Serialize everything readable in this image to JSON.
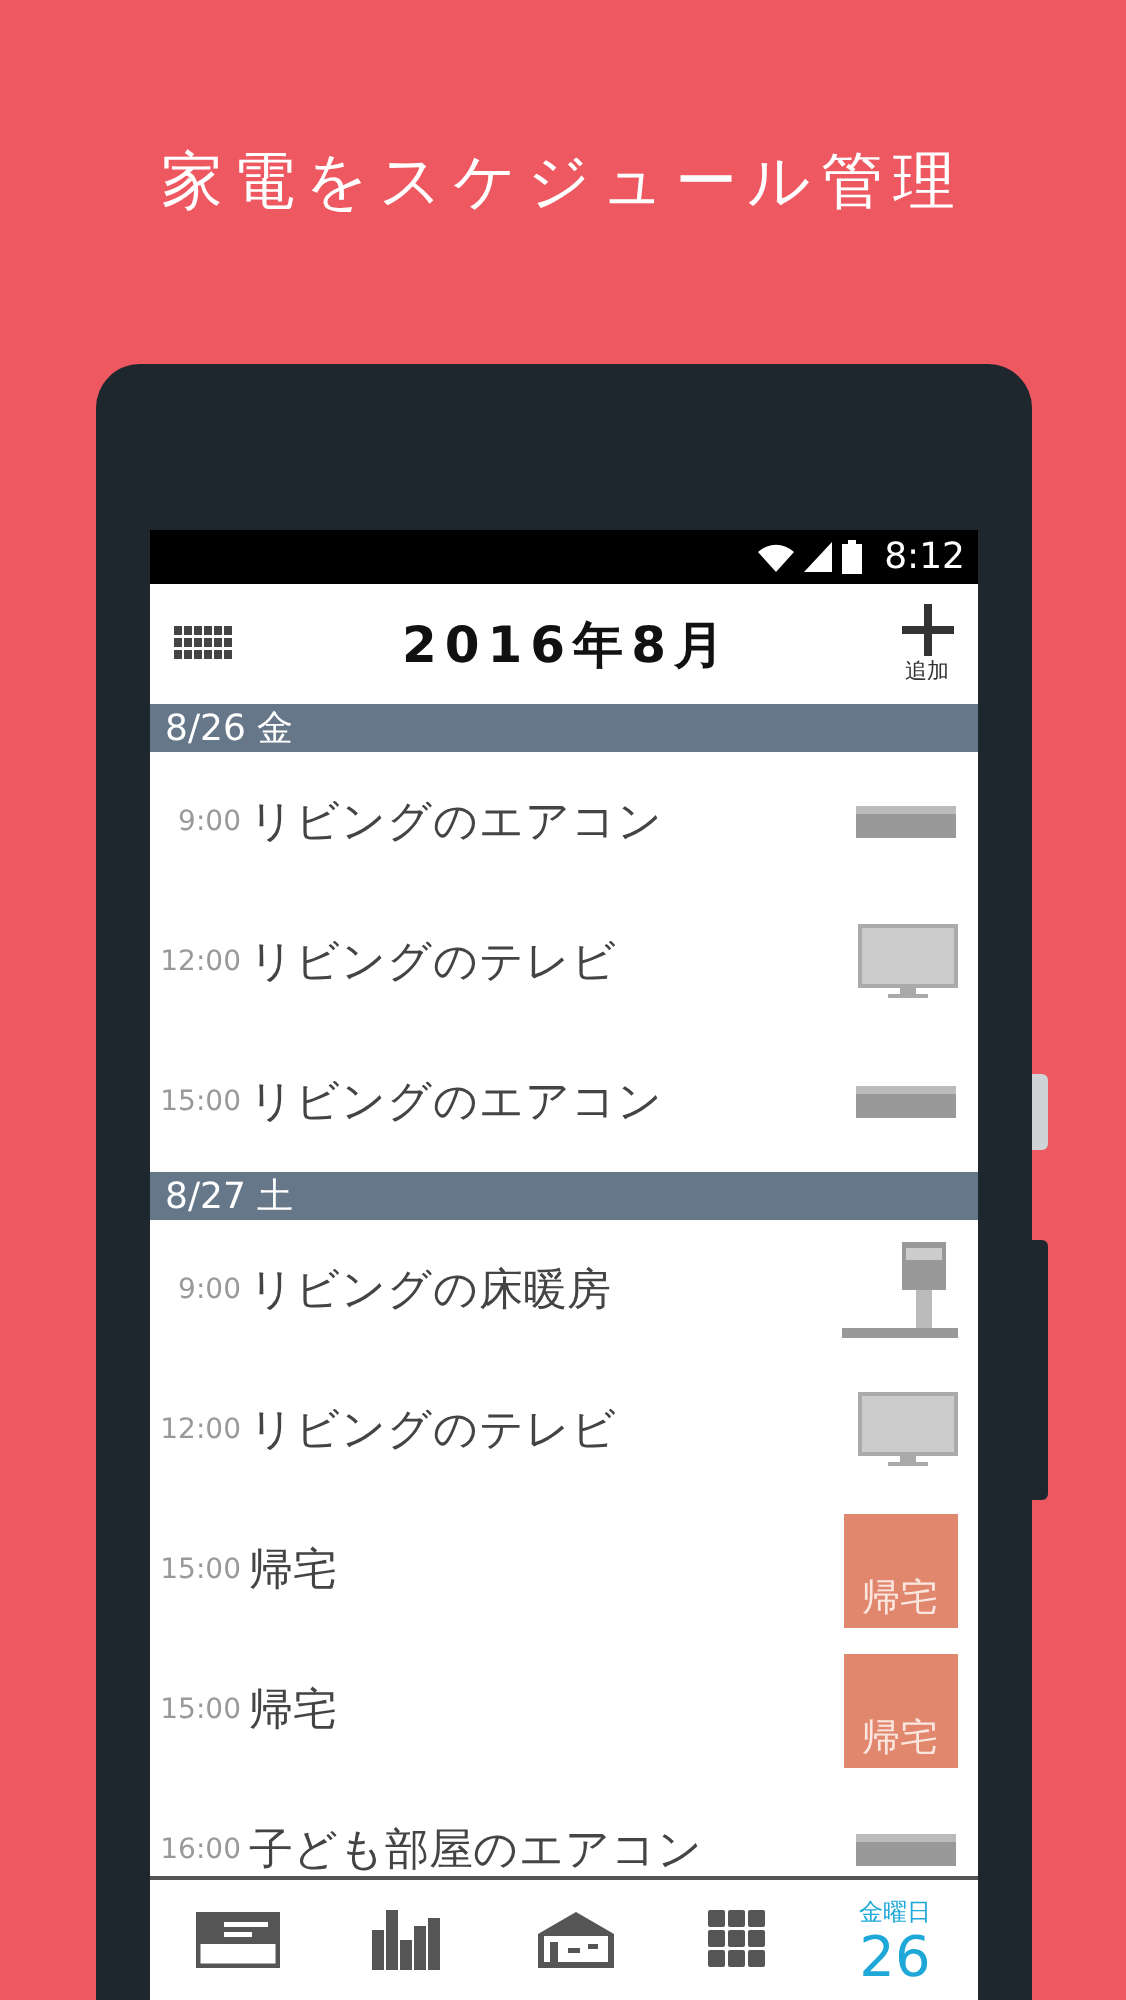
{
  "headline": "家電をスケジュール管理",
  "status_bar": {
    "time": "8:12"
  },
  "header": {
    "title": "2016年8月",
    "add_label": "追加"
  },
  "days": [
    {
      "date": "8/26 金",
      "events": [
        {
          "time": "9:00",
          "title": "リビングのエアコン",
          "kind": "aircon"
        },
        {
          "time": "12:00",
          "title": "リビングのテレビ",
          "kind": "tv"
        },
        {
          "time": "15:00",
          "title": "リビングのエアコン",
          "kind": "aircon"
        }
      ]
    },
    {
      "date": "8/27 土",
      "events": [
        {
          "time": "9:00",
          "title": "リビングの床暖房",
          "kind": "heater"
        },
        {
          "time": "12:00",
          "title": "リビングのテレビ",
          "kind": "tv"
        },
        {
          "time": "15:00",
          "title": "帰宅",
          "kind": "return",
          "badge": "帰宅"
        },
        {
          "time": "15:00",
          "title": "帰宅",
          "kind": "return",
          "badge": "帰宅"
        },
        {
          "time": "16:00",
          "title": "子ども部屋のエアコン",
          "kind": "aircon"
        }
      ]
    }
  ],
  "nav": [
    {
      "kind": "card",
      "selected": false
    },
    {
      "kind": "chart",
      "selected": false
    },
    {
      "kind": "home",
      "selected": false
    },
    {
      "kind": "grid",
      "selected": false
    },
    {
      "kind": "today",
      "selected": true,
      "weekday": "金曜日",
      "day": "26"
    }
  ]
}
